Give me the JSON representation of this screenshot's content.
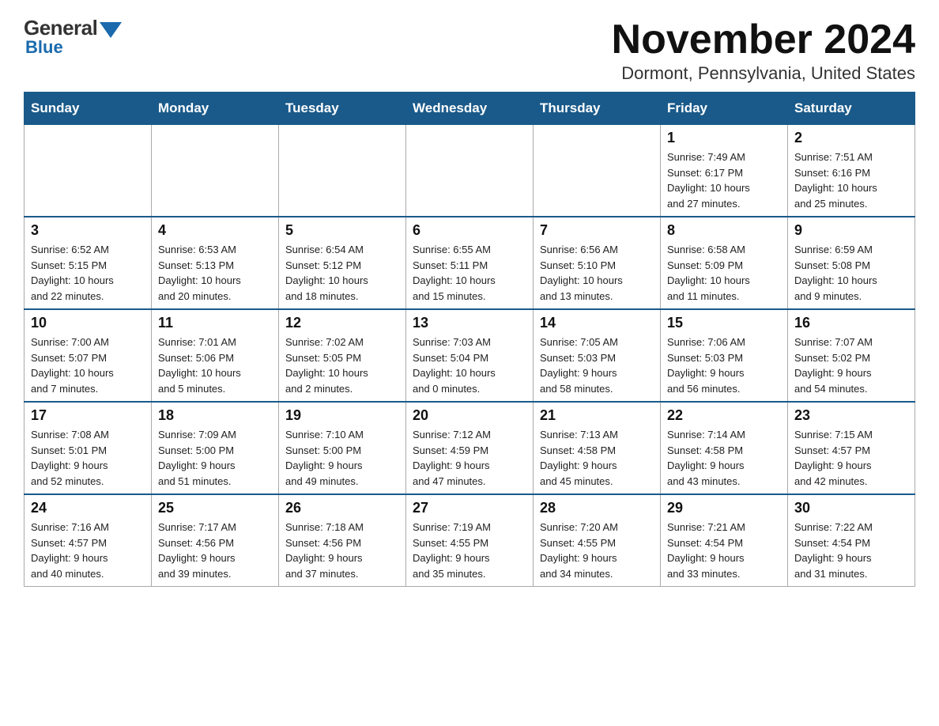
{
  "logo": {
    "general_text": "General",
    "blue_text": "Blue"
  },
  "title": "November 2024",
  "location": "Dormont, Pennsylvania, United States",
  "weekdays": [
    "Sunday",
    "Monday",
    "Tuesday",
    "Wednesday",
    "Thursday",
    "Friday",
    "Saturday"
  ],
  "weeks": [
    [
      {
        "day": "",
        "info": ""
      },
      {
        "day": "",
        "info": ""
      },
      {
        "day": "",
        "info": ""
      },
      {
        "day": "",
        "info": ""
      },
      {
        "day": "",
        "info": ""
      },
      {
        "day": "1",
        "info": "Sunrise: 7:49 AM\nSunset: 6:17 PM\nDaylight: 10 hours\nand 27 minutes."
      },
      {
        "day": "2",
        "info": "Sunrise: 7:51 AM\nSunset: 6:16 PM\nDaylight: 10 hours\nand 25 minutes."
      }
    ],
    [
      {
        "day": "3",
        "info": "Sunrise: 6:52 AM\nSunset: 5:15 PM\nDaylight: 10 hours\nand 22 minutes."
      },
      {
        "day": "4",
        "info": "Sunrise: 6:53 AM\nSunset: 5:13 PM\nDaylight: 10 hours\nand 20 minutes."
      },
      {
        "day": "5",
        "info": "Sunrise: 6:54 AM\nSunset: 5:12 PM\nDaylight: 10 hours\nand 18 minutes."
      },
      {
        "day": "6",
        "info": "Sunrise: 6:55 AM\nSunset: 5:11 PM\nDaylight: 10 hours\nand 15 minutes."
      },
      {
        "day": "7",
        "info": "Sunrise: 6:56 AM\nSunset: 5:10 PM\nDaylight: 10 hours\nand 13 minutes."
      },
      {
        "day": "8",
        "info": "Sunrise: 6:58 AM\nSunset: 5:09 PM\nDaylight: 10 hours\nand 11 minutes."
      },
      {
        "day": "9",
        "info": "Sunrise: 6:59 AM\nSunset: 5:08 PM\nDaylight: 10 hours\nand 9 minutes."
      }
    ],
    [
      {
        "day": "10",
        "info": "Sunrise: 7:00 AM\nSunset: 5:07 PM\nDaylight: 10 hours\nand 7 minutes."
      },
      {
        "day": "11",
        "info": "Sunrise: 7:01 AM\nSunset: 5:06 PM\nDaylight: 10 hours\nand 5 minutes."
      },
      {
        "day": "12",
        "info": "Sunrise: 7:02 AM\nSunset: 5:05 PM\nDaylight: 10 hours\nand 2 minutes."
      },
      {
        "day": "13",
        "info": "Sunrise: 7:03 AM\nSunset: 5:04 PM\nDaylight: 10 hours\nand 0 minutes."
      },
      {
        "day": "14",
        "info": "Sunrise: 7:05 AM\nSunset: 5:03 PM\nDaylight: 9 hours\nand 58 minutes."
      },
      {
        "day": "15",
        "info": "Sunrise: 7:06 AM\nSunset: 5:03 PM\nDaylight: 9 hours\nand 56 minutes."
      },
      {
        "day": "16",
        "info": "Sunrise: 7:07 AM\nSunset: 5:02 PM\nDaylight: 9 hours\nand 54 minutes."
      }
    ],
    [
      {
        "day": "17",
        "info": "Sunrise: 7:08 AM\nSunset: 5:01 PM\nDaylight: 9 hours\nand 52 minutes."
      },
      {
        "day": "18",
        "info": "Sunrise: 7:09 AM\nSunset: 5:00 PM\nDaylight: 9 hours\nand 51 minutes."
      },
      {
        "day": "19",
        "info": "Sunrise: 7:10 AM\nSunset: 5:00 PM\nDaylight: 9 hours\nand 49 minutes."
      },
      {
        "day": "20",
        "info": "Sunrise: 7:12 AM\nSunset: 4:59 PM\nDaylight: 9 hours\nand 47 minutes."
      },
      {
        "day": "21",
        "info": "Sunrise: 7:13 AM\nSunset: 4:58 PM\nDaylight: 9 hours\nand 45 minutes."
      },
      {
        "day": "22",
        "info": "Sunrise: 7:14 AM\nSunset: 4:58 PM\nDaylight: 9 hours\nand 43 minutes."
      },
      {
        "day": "23",
        "info": "Sunrise: 7:15 AM\nSunset: 4:57 PM\nDaylight: 9 hours\nand 42 minutes."
      }
    ],
    [
      {
        "day": "24",
        "info": "Sunrise: 7:16 AM\nSunset: 4:57 PM\nDaylight: 9 hours\nand 40 minutes."
      },
      {
        "day": "25",
        "info": "Sunrise: 7:17 AM\nSunset: 4:56 PM\nDaylight: 9 hours\nand 39 minutes."
      },
      {
        "day": "26",
        "info": "Sunrise: 7:18 AM\nSunset: 4:56 PM\nDaylight: 9 hours\nand 37 minutes."
      },
      {
        "day": "27",
        "info": "Sunrise: 7:19 AM\nSunset: 4:55 PM\nDaylight: 9 hours\nand 35 minutes."
      },
      {
        "day": "28",
        "info": "Sunrise: 7:20 AM\nSunset: 4:55 PM\nDaylight: 9 hours\nand 34 minutes."
      },
      {
        "day": "29",
        "info": "Sunrise: 7:21 AM\nSunset: 4:54 PM\nDaylight: 9 hours\nand 33 minutes."
      },
      {
        "day": "30",
        "info": "Sunrise: 7:22 AM\nSunset: 4:54 PM\nDaylight: 9 hours\nand 31 minutes."
      }
    ]
  ]
}
